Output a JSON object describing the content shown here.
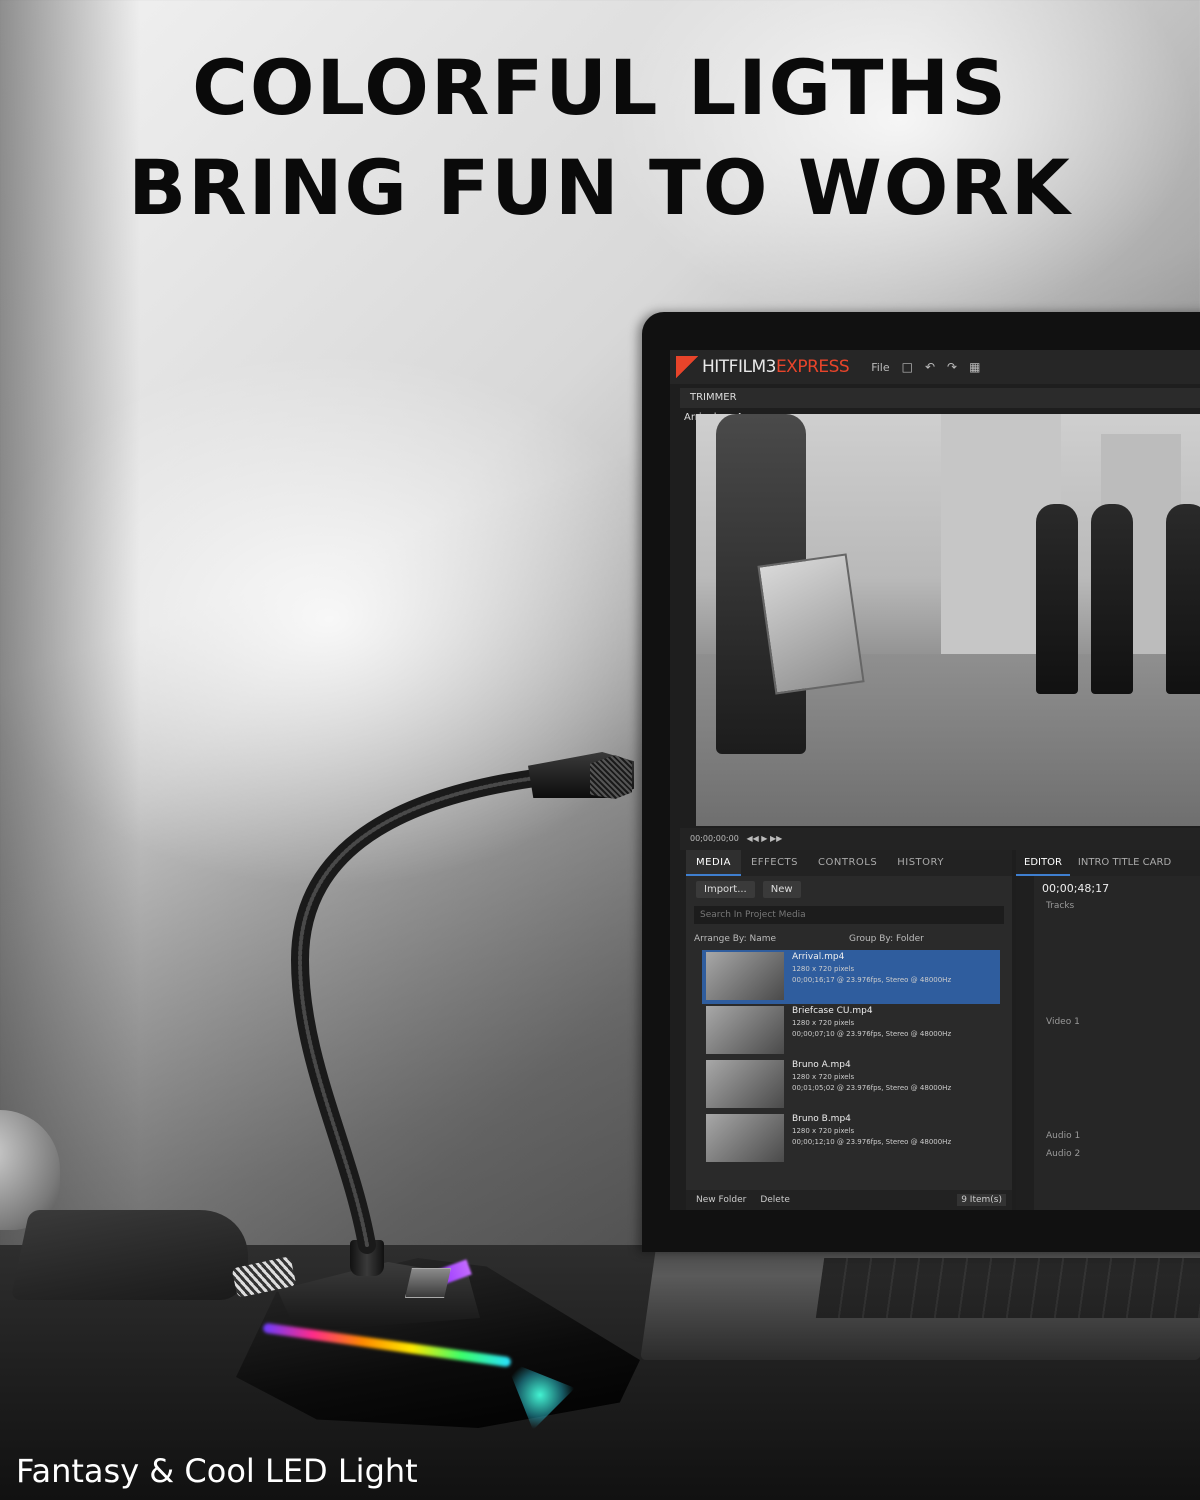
{
  "headline": {
    "line1": "COLORFUL LIGTHS",
    "line2": "BRING FUN TO WORK"
  },
  "caption": "Fantasy & Cool LED Light",
  "screen": {
    "app_name_main": "HITFILM3",
    "app_name_accent": "EXPRESS",
    "menu_file": "File",
    "trimmer_tab": "TRIMMER",
    "clip_name": "Arrival.mp4",
    "transport_timecode": "00;00;00;00",
    "media_tabs": [
      "MEDIA",
      "EFFECTS",
      "CONTROLS",
      "HISTORY"
    ],
    "import_label": "Import...",
    "new_label": "New",
    "search_placeholder": "Search In Project Media",
    "arrange_by": "Arrange By: Name",
    "group_by": "Group By: Folder",
    "media_items": [
      {
        "name": "Arrival.mp4",
        "res": "1280 x 720 pixels",
        "info": "00;00;16;17 @ 23.976fps, Stereo @ 48000Hz"
      },
      {
        "name": "Briefcase CU.mp4",
        "res": "1280 x 720 pixels",
        "info": "00;00;07;10 @ 23.976fps, Stereo @ 48000Hz"
      },
      {
        "name": "Bruno A.mp4",
        "res": "1280 x 720 pixels",
        "info": "00;01;05;02 @ 23.976fps, Stereo @ 48000Hz"
      },
      {
        "name": "Bruno B.mp4",
        "res": "1280 x 720 pixels",
        "info": "00;00;12;10 @ 23.976fps, Stereo @ 48000Hz"
      }
    ],
    "new_folder": "New Folder",
    "delete": "Delete",
    "item_count": "9 Item(s)",
    "editor_tabs": [
      "EDITOR",
      "INTRO TITLE CARD"
    ],
    "editor_timecode": "00;00;48;17",
    "tracks_label": "Tracks",
    "video_track": "Video 1",
    "audio_tracks": [
      "Audio 1",
      "Audio 2"
    ]
  },
  "colors": {
    "accent_blue": "#3f7fd0",
    "hitfilm_orange": "#e8442a"
  }
}
